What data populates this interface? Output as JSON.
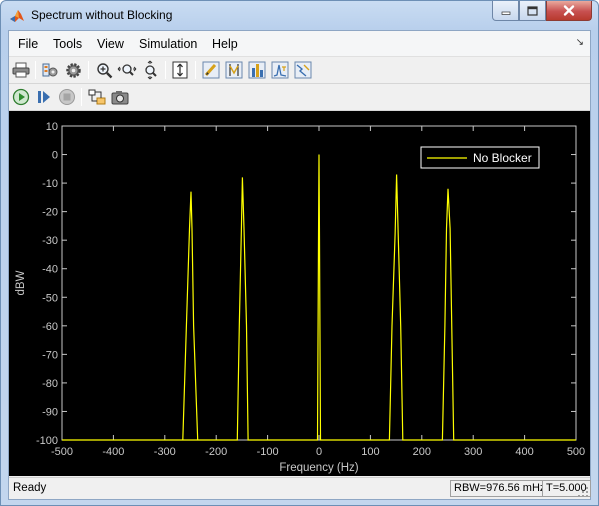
{
  "window": {
    "title": "Spectrum without Blocking"
  },
  "menu": [
    "File",
    "Tools",
    "View",
    "Simulation",
    "Help"
  ],
  "toolbar": {
    "row1_icons": [
      "print-icon",
      "parameters-icon",
      "settings-gear-icon",
      "zoom-in-icon",
      "zoom-x-icon",
      "zoom-y-icon",
      "scale-axes-icon",
      "measurements-icon",
      "cursor-measure-icon",
      "peak-finder-icon",
      "channel-measure-icon",
      "distortion-measure-icon"
    ],
    "row2_icons": [
      "run-icon",
      "step-forward-icon",
      "stop-icon",
      "highlight-block-icon",
      "snapshot-icon"
    ]
  },
  "status": {
    "left": "Ready",
    "rbw": "RBW=976.56 mHz",
    "time": "T=5.000"
  },
  "chart_data": {
    "type": "line",
    "xlabel": "Frequency (Hz)",
    "ylabel": "dBW",
    "xlim": [
      -500,
      500
    ],
    "ylim": [
      -100,
      10
    ],
    "xticks": [
      -500,
      -400,
      -300,
      -200,
      -100,
      0,
      100,
      200,
      300,
      400,
      500
    ],
    "yticks": [
      10,
      0,
      -10,
      -20,
      -30,
      -40,
      -50,
      -60,
      -70,
      -80,
      -90,
      -100
    ],
    "grid": false,
    "legend_position": "top-right",
    "background": "#000000",
    "series": [
      {
        "name": "No Blocker",
        "color": "#ffff00",
        "x": [
          -500,
          -265,
          -258,
          -252,
          -249,
          -247,
          -244,
          -236,
          -500,
          -159,
          -155,
          -151,
          -149,
          -146,
          -141,
          -138,
          -3,
          -1,
          0,
          1,
          3,
          137,
          142,
          148,
          151,
          154,
          159,
          163,
          240,
          245,
          248,
          251,
          255,
          262,
          500
        ],
        "y": [
          -100,
          -100,
          -60,
          -26,
          -13,
          -26,
          -60,
          -100,
          -100,
          -100,
          -60,
          -26,
          -8,
          -26,
          -60,
          -100,
          -100,
          -30,
          0,
          -30,
          -100,
          -100,
          -60,
          -28,
          -7,
          -28,
          -60,
          -100,
          -100,
          -60,
          -26,
          -12,
          -26,
          -100,
          -100
        ]
      }
    ]
  }
}
